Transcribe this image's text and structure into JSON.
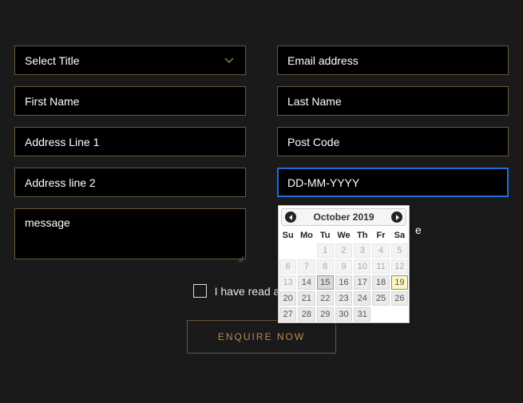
{
  "fields": {
    "title_placeholder": "Select Title",
    "email_placeholder": "Email address",
    "firstname_placeholder": "First Name",
    "lastname_placeholder": "Last Name",
    "address1_placeholder": "Address Line 1",
    "postcode_placeholder": "Post Code",
    "address2_placeholder": "Address line 2",
    "date_placeholder": "DD-MM-YYYY",
    "date_value": "",
    "message_placeholder": "message"
  },
  "consent": {
    "label": "I have read and agree t",
    "checked": false
  },
  "obscured_tail": "e",
  "submit_label": "ENQUIRE NOW",
  "datepicker": {
    "title": "October 2019",
    "dow": [
      "Su",
      "Mo",
      "Tu",
      "We",
      "Th",
      "Fr",
      "Sa"
    ],
    "weeks": [
      [
        {
          "n": "",
          "state": "empty"
        },
        {
          "n": "",
          "state": "empty"
        },
        {
          "n": "1",
          "state": "muted"
        },
        {
          "n": "2",
          "state": "muted"
        },
        {
          "n": "3",
          "state": "muted"
        },
        {
          "n": "4",
          "state": "muted"
        },
        {
          "n": "5",
          "state": "muted"
        }
      ],
      [
        {
          "n": "6",
          "state": "muted"
        },
        {
          "n": "7",
          "state": "muted"
        },
        {
          "n": "8",
          "state": "muted"
        },
        {
          "n": "9",
          "state": "muted"
        },
        {
          "n": "10",
          "state": "muted"
        },
        {
          "n": "11",
          "state": "muted"
        },
        {
          "n": "12",
          "state": "muted"
        }
      ],
      [
        {
          "n": "13",
          "state": "muted"
        },
        {
          "n": "14",
          "state": "normal"
        },
        {
          "n": "15",
          "state": "hover"
        },
        {
          "n": "16",
          "state": "normal"
        },
        {
          "n": "17",
          "state": "normal"
        },
        {
          "n": "18",
          "state": "normal"
        },
        {
          "n": "19",
          "state": "today"
        }
      ],
      [
        {
          "n": "20",
          "state": "normal"
        },
        {
          "n": "21",
          "state": "normal"
        },
        {
          "n": "22",
          "state": "normal"
        },
        {
          "n": "23",
          "state": "normal"
        },
        {
          "n": "24",
          "state": "normal"
        },
        {
          "n": "25",
          "state": "normal"
        },
        {
          "n": "26",
          "state": "normal"
        }
      ],
      [
        {
          "n": "27",
          "state": "normal"
        },
        {
          "n": "28",
          "state": "normal"
        },
        {
          "n": "29",
          "state": "normal"
        },
        {
          "n": "30",
          "state": "normal"
        },
        {
          "n": "31",
          "state": "normal"
        },
        {
          "n": "",
          "state": "empty"
        },
        {
          "n": "",
          "state": "empty"
        }
      ]
    ]
  },
  "colors": {
    "border": "#6b573a",
    "accent": "#b98b4e",
    "focus": "#1f6fd6",
    "bg": "#1a1a1a"
  }
}
